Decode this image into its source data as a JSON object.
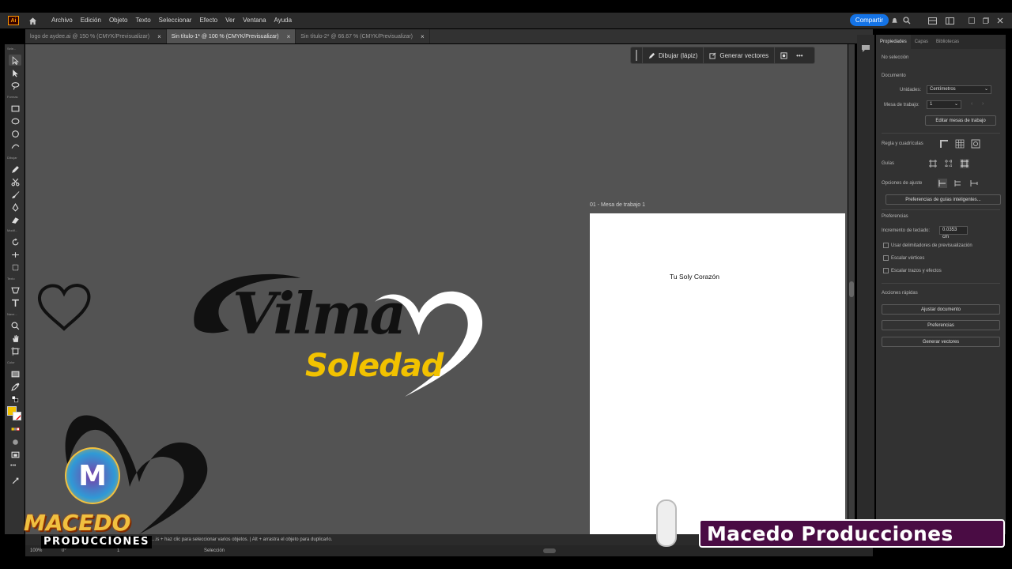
{
  "app": {
    "logo": "Ai",
    "home_icon": "home-icon"
  },
  "menu": [
    "Archivo",
    "Edición",
    "Objeto",
    "Texto",
    "Seleccionar",
    "Efecto",
    "Ver",
    "Ventana",
    "Ayuda"
  ],
  "titlebar": {
    "share": "Compartir"
  },
  "tabs": [
    {
      "label": "logo de aydee.ai @ 150 % (CMYK/Previsualizar)",
      "active": false
    },
    {
      "label": "Sin título-1* @ 100 % (CMYK/Previsualizar)",
      "active": true
    },
    {
      "label": "Sin título-2* @ 66.67 % (CMYK/Previsualizar)",
      "active": false
    }
  ],
  "tab_close": "×",
  "toolbar": {
    "labels": [
      "Sele...",
      "Formas",
      "Dibujar",
      "Modif...",
      "Texto",
      "Nave...",
      "Color"
    ],
    "more": "•••"
  },
  "context_bar": {
    "draw": "Dibujar (lápiz)",
    "vectors": "Generar vectores",
    "more": "•••"
  },
  "artboard": {
    "label": "01 - Mesa de trabajo 1",
    "text": "Tu Soly Corazón"
  },
  "artwork": {
    "title": "Vilma",
    "subtitle": "Soledad",
    "title_color": "#111111",
    "subtitle_color": "#f2c200"
  },
  "panel": {
    "tabs": [
      "Propiedades",
      "Capas",
      "Bibliotecas"
    ],
    "no_selection": "No selección",
    "document": "Documento",
    "units_label": "Unidades:",
    "units_value": "Centímetros",
    "artboard_label": "Mesa de trabajo:",
    "artboard_value": "1",
    "edit_artboards": "Editar mesas de trabajo",
    "rulers_grids": "Regla y cuadrículas",
    "guides": "Guías",
    "snap_options": "Opciones de ajuste",
    "smart_guides": "Preferencias de guías inteligentes...",
    "preferences": "Preferencias",
    "keyboard_increment_label": "Incremento de teclado:",
    "keyboard_increment_value": "0.0353 cm",
    "checks": [
      "Usar delimitadores de previsualización",
      "Escalar vértices",
      "Escalar trazos y efectos"
    ],
    "quick_actions": "Acciones rápidas",
    "buttons": [
      "Ajustar documento",
      "Preferencias",
      "Generar vectores"
    ]
  },
  "status": {
    "hint": "...is + haz clic para seleccionar varios objetos.  |  Alt + arrastra el objeto para duplicarlo.",
    "zoom": "100%",
    "rotation": "0°",
    "artboard": "1",
    "tool": "Selección"
  },
  "watermark": {
    "brand": "MACEDO",
    "sub": "PRODUCCIONES",
    "banner": "Macedo Producciones",
    "badge": "M"
  }
}
